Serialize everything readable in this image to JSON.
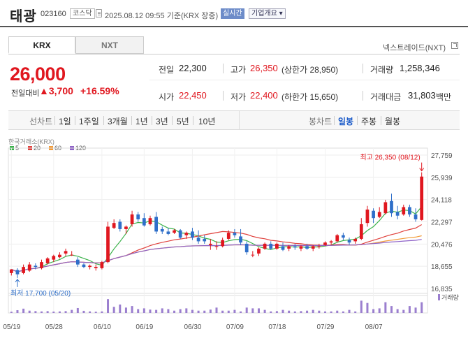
{
  "header": {
    "stock_name": "태광",
    "stock_code": "023160",
    "market_badge": "코스닥",
    "datetime": "2025.08.12 09:55",
    "basis": "기준(KRX 장중)",
    "realtime_label": "실시간",
    "overview_label": "기업개요 ▾"
  },
  "market_tabs": [
    {
      "label": "KRX",
      "active": true
    },
    {
      "label": "NXT",
      "active": false
    }
  ],
  "nextrade_link": "넥스트레이드(NXT)",
  "quote": {
    "price": "26,000",
    "change_label": "전일대비",
    "change_value": "▲3,700",
    "change_pct": "+16.59%",
    "stats": {
      "prev_label": "전일",
      "prev_value": "22,300",
      "high_label": "고가",
      "high_value": "26,350",
      "high_extra": "(상한가 28,950)",
      "volume_label": "거래량",
      "volume_value": "1,258,346",
      "open_label": "시가",
      "open_value": "22,450",
      "low_label": "저가",
      "low_value": "22,400",
      "low_extra": "(하한가 15,650)",
      "amount_label": "거래대금",
      "amount_value": "31,803",
      "amount_unit": "백만"
    }
  },
  "period": {
    "label": "선차트",
    "buttons": [
      "1일",
      "1주일",
      "3개월",
      "1년",
      "3년",
      "5년",
      "10년"
    ],
    "candle_label": "봉차트",
    "candle_buttons": [
      {
        "label": "일봉",
        "active": true
      },
      {
        "label": "주봉",
        "active": false
      },
      {
        "label": "월봉",
        "active": false
      }
    ]
  },
  "chart": {
    "source": "한국거래소(KRX)",
    "legend": [
      {
        "label": "5",
        "color": "#3bb24a"
      },
      {
        "label": "20",
        "color": "#e0403c"
      },
      {
        "label": "60",
        "color": "#f29b38"
      },
      {
        "label": "120",
        "color": "#8e62c7"
      }
    ],
    "up_color": "#e0171f",
    "down_color": "#2f6fc9",
    "volume_color": "#9b7fcf",
    "y_ticks": [
      "27,759",
      "25,939",
      "24,118",
      "22,297",
      "20,476",
      "18,655",
      "16,835"
    ],
    "x_ticks": [
      "05/19",
      "05/28",
      "06/10",
      "06/19",
      "06/30",
      "07/09",
      "07/18",
      "07/29",
      "08/07"
    ],
    "high_annotation": "최고 26,350 (08/12)",
    "low_annotation": "최저 17,700 (05/20)",
    "volume_label": "거래량"
  },
  "chart_data": {
    "type": "candlestick",
    "y_range": [
      16835,
      27759
    ],
    "candles": [
      {
        "o": 18100,
        "h": 18400,
        "l": 17900,
        "c": 18400
      },
      {
        "o": 18350,
        "h": 18500,
        "l": 17700,
        "c": 18000
      },
      {
        "o": 18100,
        "h": 18800,
        "l": 18000,
        "c": 18600
      },
      {
        "o": 18300,
        "h": 19000,
        "l": 18200,
        "c": 18800
      },
      {
        "o": 18700,
        "h": 18900,
        "l": 18400,
        "c": 18600
      },
      {
        "o": 18500,
        "h": 19200,
        "l": 18400,
        "c": 19000
      },
      {
        "o": 18900,
        "h": 19400,
        "l": 18800,
        "c": 19300
      },
      {
        "o": 19200,
        "h": 19600,
        "l": 19000,
        "c": 19500
      },
      {
        "o": 19400,
        "h": 19800,
        "l": 19300,
        "c": 19600
      },
      {
        "o": 19700,
        "h": 20100,
        "l": 19500,
        "c": 19900
      },
      {
        "o": 19600,
        "h": 19900,
        "l": 19500,
        "c": 19600
      },
      {
        "o": 19200,
        "h": 19400,
        "l": 18600,
        "c": 18800
      },
      {
        "o": 18800,
        "h": 18900,
        "l": 18500,
        "c": 18600
      },
      {
        "o": 18600,
        "h": 18800,
        "l": 18400,
        "c": 18700
      },
      {
        "o": 18500,
        "h": 18800,
        "l": 18300,
        "c": 18600
      },
      {
        "o": 18500,
        "h": 19100,
        "l": 18400,
        "c": 19000
      },
      {
        "o": 19000,
        "h": 22300,
        "l": 18900,
        "c": 21900
      },
      {
        "o": 21800,
        "h": 22500,
        "l": 21700,
        "c": 22200
      },
      {
        "o": 22300,
        "h": 22500,
        "l": 21500,
        "c": 21700
      },
      {
        "o": 21700,
        "h": 22000,
        "l": 21300,
        "c": 21900
      },
      {
        "o": 22100,
        "h": 23200,
        "l": 21900,
        "c": 22900
      },
      {
        "o": 22900,
        "h": 23100,
        "l": 22300,
        "c": 22500
      },
      {
        "o": 22600,
        "h": 23000,
        "l": 21900,
        "c": 22000
      },
      {
        "o": 22100,
        "h": 22800,
        "l": 22000,
        "c": 22600
      },
      {
        "o": 22700,
        "h": 23100,
        "l": 21300,
        "c": 21500
      },
      {
        "o": 21700,
        "h": 21900,
        "l": 21300,
        "c": 21500
      },
      {
        "o": 21500,
        "h": 21800,
        "l": 21200,
        "c": 21300
      },
      {
        "o": 21400,
        "h": 21700,
        "l": 21300,
        "c": 21600
      },
      {
        "o": 21600,
        "h": 21700,
        "l": 20900,
        "c": 21000
      },
      {
        "o": 21200,
        "h": 21500,
        "l": 20900,
        "c": 21400
      },
      {
        "o": 21500,
        "h": 21800,
        "l": 20800,
        "c": 21000
      },
      {
        "o": 21000,
        "h": 21600,
        "l": 20500,
        "c": 20700
      },
      {
        "o": 20900,
        "h": 21200,
        "l": 20500,
        "c": 20700
      },
      {
        "o": 20400,
        "h": 20900,
        "l": 20000,
        "c": 20500
      },
      {
        "o": 20300,
        "h": 20700,
        "l": 20000,
        "c": 20300
      },
      {
        "o": 20300,
        "h": 21000,
        "l": 20200,
        "c": 20800
      },
      {
        "o": 20900,
        "h": 21600,
        "l": 20800,
        "c": 21400
      },
      {
        "o": 21400,
        "h": 21700,
        "l": 21000,
        "c": 21200
      },
      {
        "o": 21100,
        "h": 21700,
        "l": 20400,
        "c": 20600
      },
      {
        "o": 20500,
        "h": 20700,
        "l": 19600,
        "c": 19800
      },
      {
        "o": 19600,
        "h": 19900,
        "l": 19400,
        "c": 19600
      },
      {
        "o": 19700,
        "h": 20200,
        "l": 19500,
        "c": 20100
      },
      {
        "o": 20100,
        "h": 20600,
        "l": 20000,
        "c": 20500
      },
      {
        "o": 20500,
        "h": 20700,
        "l": 20000,
        "c": 20100
      },
      {
        "o": 20100,
        "h": 20600,
        "l": 20000,
        "c": 20500
      },
      {
        "o": 20300,
        "h": 20600,
        "l": 19900,
        "c": 20000
      },
      {
        "o": 20100,
        "h": 20400,
        "l": 19900,
        "c": 20300
      },
      {
        "o": 20300,
        "h": 20500,
        "l": 20000,
        "c": 20200
      },
      {
        "o": 20100,
        "h": 20400,
        "l": 19900,
        "c": 20300
      },
      {
        "o": 20300,
        "h": 20500,
        "l": 20000,
        "c": 20100
      },
      {
        "o": 20100,
        "h": 20400,
        "l": 19900,
        "c": 20300
      },
      {
        "o": 20300,
        "h": 20500,
        "l": 20100,
        "c": 20300
      },
      {
        "o": 20400,
        "h": 20700,
        "l": 20300,
        "c": 20600
      },
      {
        "o": 20600,
        "h": 20800,
        "l": 20400,
        "c": 20700
      },
      {
        "o": 20700,
        "h": 21300,
        "l": 20600,
        "c": 21200
      },
      {
        "o": 21200,
        "h": 21400,
        "l": 20800,
        "c": 21000
      },
      {
        "o": 20800,
        "h": 21000,
        "l": 20400,
        "c": 20600
      },
      {
        "o": 20700,
        "h": 21000,
        "l": 20500,
        "c": 20900
      },
      {
        "o": 20900,
        "h": 22600,
        "l": 20800,
        "c": 22100
      },
      {
        "o": 22200,
        "h": 23600,
        "l": 21900,
        "c": 23300
      },
      {
        "o": 23200,
        "h": 23400,
        "l": 22200,
        "c": 22600
      },
      {
        "o": 22700,
        "h": 23500,
        "l": 22600,
        "c": 23100
      },
      {
        "o": 23000,
        "h": 24100,
        "l": 22900,
        "c": 23900
      },
      {
        "o": 24000,
        "h": 24600,
        "l": 22700,
        "c": 23000
      },
      {
        "o": 23100,
        "h": 23600,
        "l": 22500,
        "c": 22800
      },
      {
        "o": 22900,
        "h": 23700,
        "l": 22800,
        "c": 23500
      },
      {
        "o": 23500,
        "h": 23700,
        "l": 22700,
        "c": 22900
      },
      {
        "o": 22900,
        "h": 23400,
        "l": 22300,
        "c": 22500
      },
      {
        "o": 22450,
        "h": 26350,
        "l": 22400,
        "c": 26000
      }
    ],
    "volume_relative": [
      0.08,
      0.18,
      0.28,
      0.15,
      0.12,
      0.1,
      0.12,
      0.09,
      0.1,
      0.12,
      0.2,
      0.32,
      0.14,
      0.1,
      0.08,
      0.1,
      0.9,
      0.4,
      0.55,
      0.35,
      0.45,
      0.25,
      0.3,
      0.22,
      0.2,
      0.3,
      0.25,
      0.15,
      0.25,
      0.3,
      0.2,
      0.15,
      0.15,
      0.22,
      0.35,
      0.15,
      0.15,
      0.2,
      0.1,
      0.35,
      0.3,
      0.3,
      0.2,
      0.1,
      0.12,
      0.2,
      0.15,
      0.1,
      0.12,
      0.15,
      0.2,
      0.15,
      0.1,
      0.1,
      0.15,
      0.1,
      0.2,
      0.1,
      0.8,
      0.65,
      0.25,
      0.3,
      0.7,
      0.45,
      0.25,
      0.2,
      0.45,
      0.35,
      0.7
    ]
  }
}
